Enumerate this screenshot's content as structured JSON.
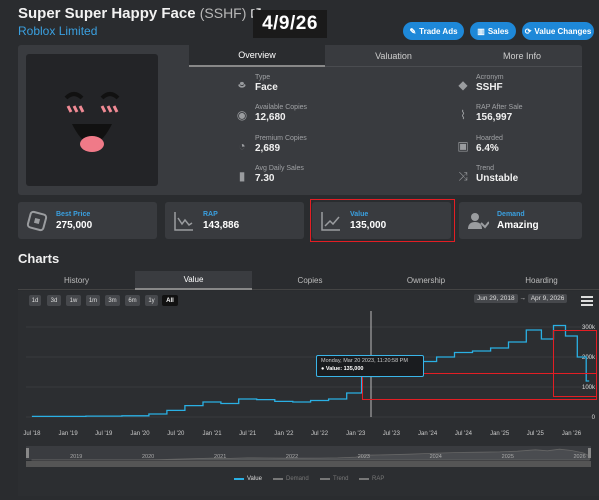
{
  "header": {
    "title": "Super Super Happy Face",
    "acronym": "(SSHF)",
    "subtitle": "Roblox Limited",
    "date_stamp": "4/9/26",
    "buttons": [
      "Trade Ads",
      "Sales",
      "Value Changes"
    ]
  },
  "info_tabs": [
    "Overview",
    "Valuation",
    "More Info"
  ],
  "stats": {
    "type": {
      "label": "Type",
      "value": "Face"
    },
    "available": {
      "label": "Available Copies",
      "value": "12,680"
    },
    "premium": {
      "label": "Premium Copies",
      "value": "2,689"
    },
    "avg_sales": {
      "label": "Avg Daily Sales",
      "value": "7.30"
    },
    "acronym": {
      "label": "Acronym",
      "value": "SSHF"
    },
    "rap_after": {
      "label": "RAP After Sale",
      "value": "156,997"
    },
    "hoarded": {
      "label": "Hoarded",
      "value": "6.4%"
    },
    "trend": {
      "label": "Trend",
      "value": "Unstable"
    }
  },
  "cards": {
    "best_price": {
      "label": "Best Price",
      "value": "275,000"
    },
    "rap": {
      "label": "RAP",
      "value": "143,886"
    },
    "value": {
      "label": "Value",
      "value": "135,000"
    },
    "demand": {
      "label": "Demand",
      "value": "Amazing"
    }
  },
  "charts": {
    "heading": "Charts",
    "tabs": [
      "History",
      "Value",
      "Copies",
      "Ownership",
      "Hoarding"
    ],
    "ranges": [
      "1d",
      "3d",
      "1w",
      "1m",
      "3m",
      "6m",
      "1y",
      "All"
    ],
    "date_from": "Jun 29, 2018",
    "date_sep": "→",
    "date_to": "Apr 9, 2026",
    "tooltip_date": "Monday, Mar 20 2023, 11:20:58 PM",
    "tooltip_value": "● Value: 135,000",
    "legend": [
      "Value",
      "Demand",
      "Trend",
      "RAP"
    ],
    "navigator_years": [
      "2019",
      "2020",
      "2021",
      "2022",
      "2023",
      "2024",
      "2025",
      "2026"
    ]
  },
  "chart_data": {
    "type": "line",
    "title": "",
    "x_ticks": [
      "Jul '18",
      "Jan '19",
      "Jul '19",
      "Jan '20",
      "Jul '20",
      "Jan '21",
      "Jul '21",
      "Jan '22",
      "Jul '22",
      "Jan '23",
      "Jul '23",
      "Jan '24",
      "Jul '24",
      "Jan '25",
      "Jul '25",
      "Jan '26"
    ],
    "y_ticks": [
      "0",
      "100k",
      "200k",
      "300k"
    ],
    "ylim": [
      0,
      340000
    ],
    "series": [
      {
        "name": "Value",
        "color": "#2ab0e4",
        "x": [
          "2018-07",
          "2019-01",
          "2019-07",
          "2020-01",
          "2020-04",
          "2020-07",
          "2020-10",
          "2021-01",
          "2021-04",
          "2021-07",
          "2021-10",
          "2022-01",
          "2022-04",
          "2022-07",
          "2022-10",
          "2023-01",
          "2023-03",
          "2023-07",
          "2023-10",
          "2024-01",
          "2024-04",
          "2024-07",
          "2024-10",
          "2025-01",
          "2025-04",
          "2025-07",
          "2025-09",
          "2025-11",
          "2026-01",
          "2026-03",
          "2026-04"
        ],
        "values": [
          2000,
          2000,
          3000,
          4000,
          10000,
          22000,
          38000,
          50000,
          45000,
          60000,
          58000,
          52000,
          50000,
          55000,
          60000,
          80000,
          135000,
          150000,
          165000,
          185000,
          200000,
          215000,
          220000,
          230000,
          250000,
          290000,
          260000,
          305000,
          270000,
          200000,
          120000
        ]
      }
    ]
  }
}
